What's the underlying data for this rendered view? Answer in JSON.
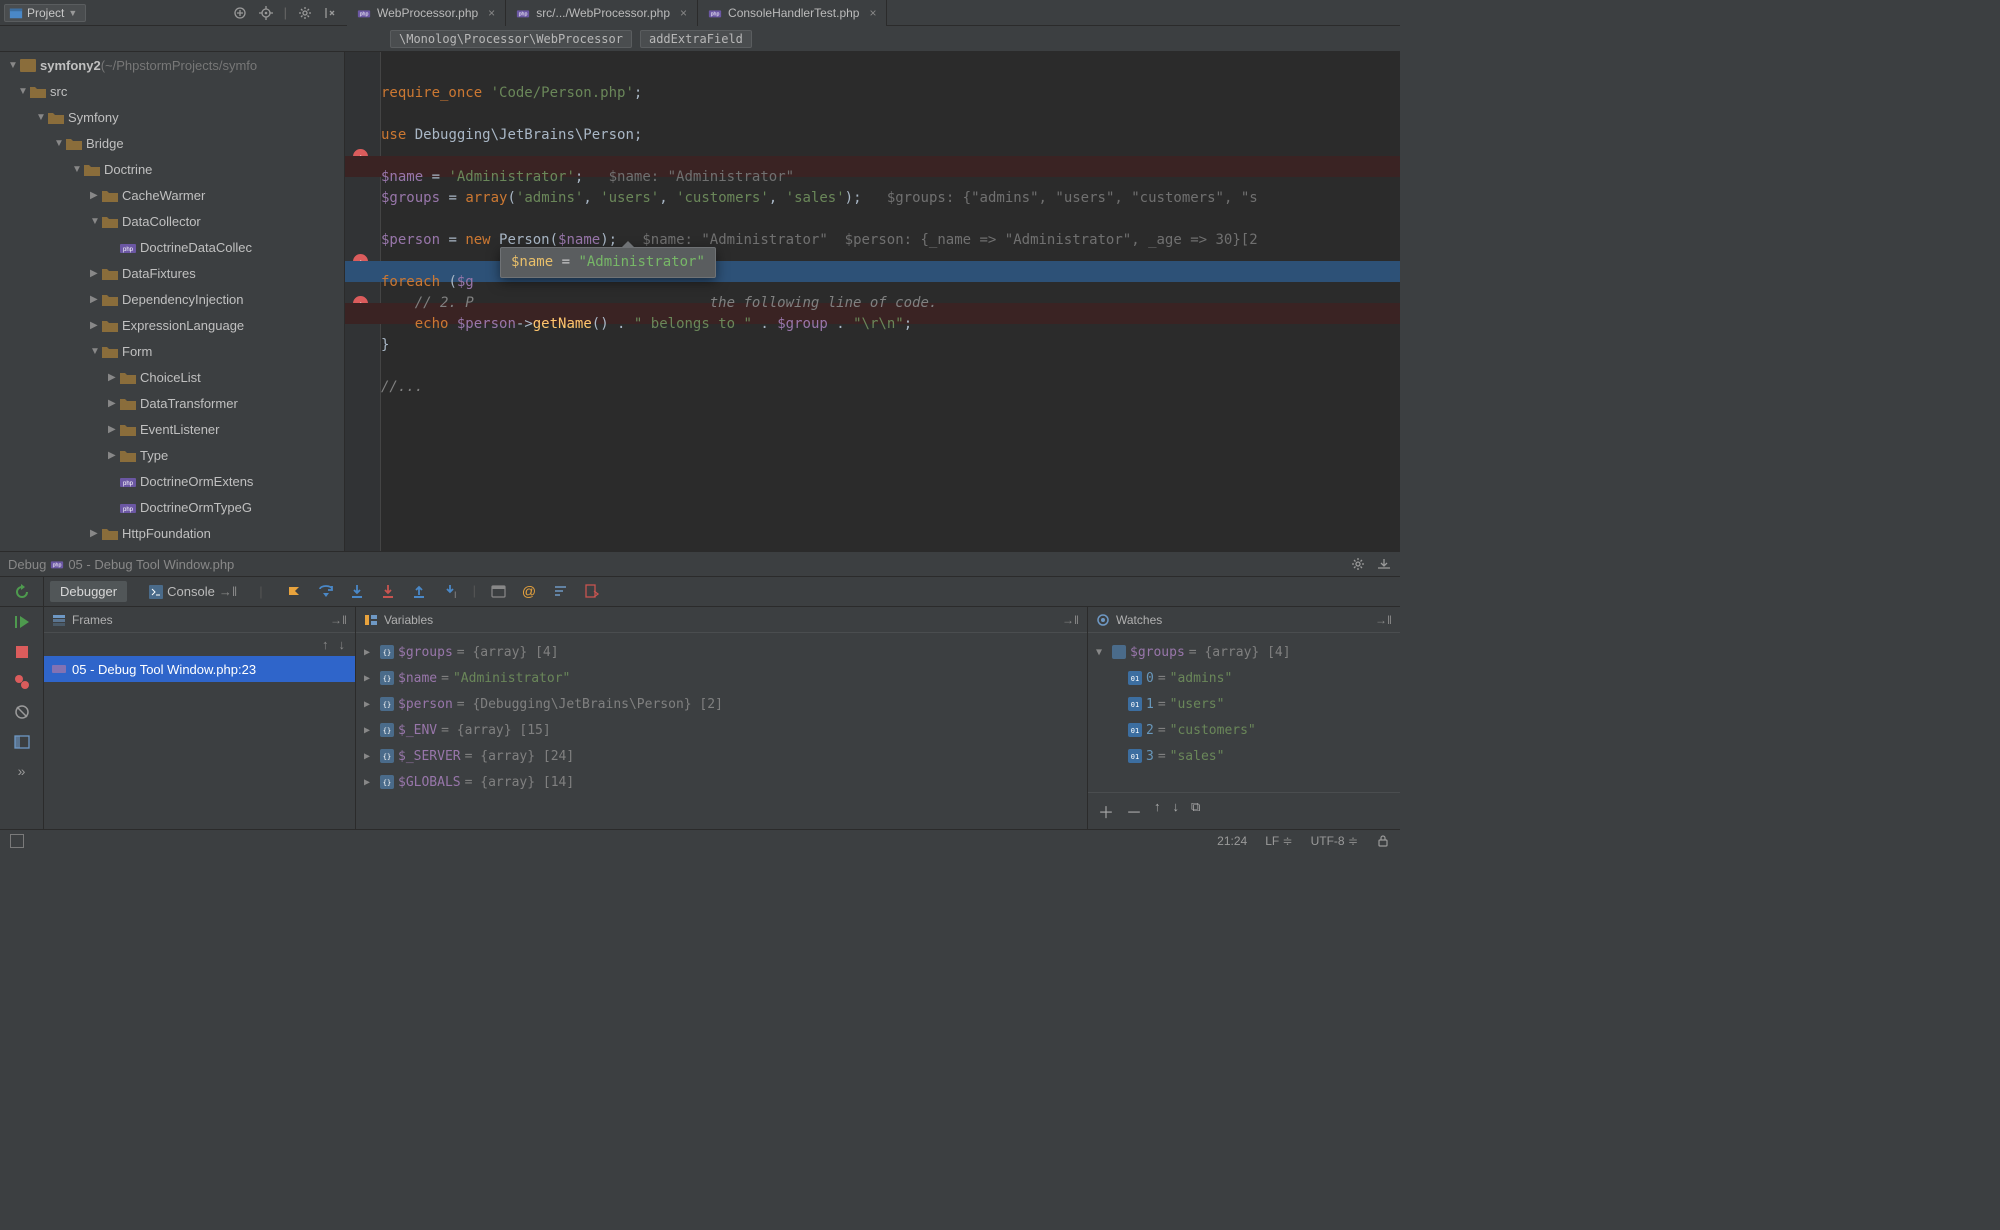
{
  "top": {
    "project_label": "Project",
    "tabs": [
      {
        "label": "WebProcessor.php"
      },
      {
        "label": "src/.../WebProcessor.php"
      },
      {
        "label": "ConsoleHandlerTest.php"
      }
    ]
  },
  "crumbs": [
    "\\Monolog\\Processor\\WebProcessor",
    "addExtraField"
  ],
  "project": {
    "root": "symfony2",
    "root_loc": " (~/PhpstormProjects/symfo",
    "items": [
      {
        "lvl": 1,
        "exp": "▼",
        "type": "dir",
        "name": "src"
      },
      {
        "lvl": 2,
        "exp": "▼",
        "type": "dir",
        "name": "Symfony"
      },
      {
        "lvl": 3,
        "exp": "▼",
        "type": "dir",
        "name": "Bridge"
      },
      {
        "lvl": 4,
        "exp": "▼",
        "type": "dir",
        "name": "Doctrine"
      },
      {
        "lvl": 5,
        "exp": "▶",
        "type": "dir",
        "name": "CacheWarmer"
      },
      {
        "lvl": 5,
        "exp": "▼",
        "type": "dir",
        "name": "DataCollector"
      },
      {
        "lvl": 6,
        "exp": "",
        "type": "php",
        "name": "DoctrineDataCollec"
      },
      {
        "lvl": 5,
        "exp": "▶",
        "type": "dir",
        "name": "DataFixtures"
      },
      {
        "lvl": 5,
        "exp": "▶",
        "type": "dir",
        "name": "DependencyInjection"
      },
      {
        "lvl": 5,
        "exp": "▶",
        "type": "dir",
        "name": "ExpressionLanguage"
      },
      {
        "lvl": 5,
        "exp": "▼",
        "type": "dir",
        "name": "Form"
      },
      {
        "lvl": 6,
        "exp": "▶",
        "type": "dir",
        "name": "ChoiceList"
      },
      {
        "lvl": 6,
        "exp": "▶",
        "type": "dir",
        "name": "DataTransformer"
      },
      {
        "lvl": 6,
        "exp": "▶",
        "type": "dir",
        "name": "EventListener"
      },
      {
        "lvl": 6,
        "exp": "▶",
        "type": "dir",
        "name": "Type"
      },
      {
        "lvl": 6,
        "exp": "",
        "type": "php",
        "name": "DoctrineOrmExtens"
      },
      {
        "lvl": 6,
        "exp": "",
        "type": "php",
        "name": "DoctrineOrmTypeG"
      },
      {
        "lvl": 5,
        "exp": "▶",
        "type": "dir",
        "name": "HttpFoundation"
      }
    ]
  },
  "code": {
    "l0a": "require_once",
    "l0b": " 'Code/Person.php'",
    "l0c": ";",
    "l1a": "use",
    "l1b": " Debugging\\JetBrains\\Person;",
    "l2a": "$name",
    "l2b": " = ",
    "l2c": "'Administrator'",
    "l2d": ";",
    "l2h": "   $name: \"Administrator\"",
    "l3a": "$groups",
    "l3b": " = ",
    "l3c": "array",
    "l3d": "(",
    "l3e": "'admins'",
    "l3f": ", ",
    "l3g": "'users'",
    "l3h": ", ",
    "l3i": "'customers'",
    "l3j": ", ",
    "l3k": "'sales'",
    "l3l": ");",
    "l3m": "   $groups: {\"admins\", \"users\", \"customers\", \"s",
    "l4a": "$person",
    "l4b": " = ",
    "l4c": "new",
    "l4d": " Person(",
    "l4e": "$name",
    "l4f": ");",
    "l4g": "   $name: \"Administrator\"  $person: {_name => \"Administrator\", _age => 30}[2",
    "l5a": "foreach",
    "l5b": " (",
    "l5c": "$g",
    "l6a": "    // 2. P",
    "l6b": "  the following line of code.",
    "l7a": "    ",
    "l7b": "echo",
    "l7c": " ",
    "l7d": "$person",
    "l7e": "->",
    "l7f": "getName",
    "l7g": "() . ",
    "l7h": "\" belongs to \"",
    "l7i": " . ",
    "l7j": "$group",
    "l7k": " . ",
    "l7l": "\"\\r\\n\"",
    "l7m": ";",
    "l8": "}",
    "l9": "//..."
  },
  "tooltip": {
    "var": "$name",
    "eq": " = ",
    "val": "\"Administrator\""
  },
  "debug": {
    "title_prefix": "Debug ",
    "title": "05 - Debug Tool Window.php",
    "tabs": {
      "debugger": "Debugger",
      "console": "Console"
    },
    "frames_hdr": "Frames",
    "vars_hdr": "Variables",
    "watch_hdr": "Watches",
    "frame": "05 - Debug Tool Window.php:23",
    "vars": [
      {
        "name": "$groups",
        "rest": " = {array} [4]"
      },
      {
        "name": "$name",
        "rest": " = ",
        "str": "\"Administrator\""
      },
      {
        "name": "$person",
        "rest": " = {Debugging\\JetBrains\\Person} [2]"
      },
      {
        "name": "$_ENV",
        "rest": " = {array} [15]"
      },
      {
        "name": "$_SERVER",
        "rest": " = {array} [24]"
      },
      {
        "name": "$GLOBALS",
        "rest": " = {array} [14]"
      }
    ],
    "watches": {
      "root": {
        "name": "$groups",
        "rest": " = {array} [4]"
      },
      "items": [
        {
          "idx": "0",
          "val": "\"admins\""
        },
        {
          "idx": "1",
          "val": "\"users\""
        },
        {
          "idx": "2",
          "val": "\"customers\""
        },
        {
          "idx": "3",
          "val": "\"sales\""
        }
      ]
    }
  },
  "status": {
    "pos": "21:24",
    "le": "LF",
    "enc": "UTF-8"
  }
}
